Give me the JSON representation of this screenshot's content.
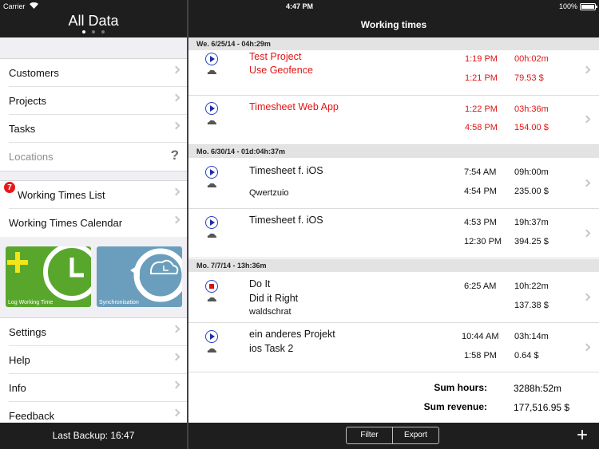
{
  "status_bar": {
    "carrier": "Carrier",
    "time": "4:47 PM",
    "battery": "100%"
  },
  "sidebar": {
    "title": "All Data",
    "group1": [
      {
        "label": "Customers"
      },
      {
        "label": "Projects"
      },
      {
        "label": "Tasks"
      },
      {
        "label": "Locations",
        "accessory": "?"
      }
    ],
    "group2": [
      {
        "label": "Working Times List",
        "badge": "7"
      },
      {
        "label": "Working Times Calendar"
      }
    ],
    "tiles": [
      {
        "label": "Log Working Time",
        "color": "#59a62d"
      },
      {
        "label": "Synchronisation",
        "color": "#6a9ebc"
      }
    ],
    "group3": [
      {
        "label": "Settings"
      },
      {
        "label": "Help"
      },
      {
        "label": "Info"
      },
      {
        "label": "Feedback"
      }
    ],
    "last_backup": "Last Backup: 16:47"
  },
  "main": {
    "title": "Working times",
    "sections": [
      {
        "header": "We. 6/25/14 - 04h:29m",
        "entries": [
          {
            "project": "Test Project",
            "task": "Use Geofence",
            "customer": "",
            "start": "1:19 PM",
            "end": "1:21 PM",
            "duration": "00h:02m",
            "amount": "79.53 $",
            "highlight": "#e01414",
            "state": "play"
          },
          {
            "project": "Timesheet Web App",
            "task": "",
            "customer": "",
            "start": "1:22 PM",
            "end": "4:58 PM",
            "duration": "03h:36m",
            "amount": "154.00 $",
            "highlight": "#e01414",
            "state": "play"
          }
        ]
      },
      {
        "header": "Mo. 6/30/14 - 01d:04h:37m",
        "entries": [
          {
            "project": "Timesheet f. iOS",
            "task": "",
            "customer": "Qwertzuio",
            "start": "7:54 AM",
            "end": "4:54 PM",
            "duration": "09h:00m",
            "amount": "235.00 $",
            "state": "play"
          },
          {
            "project": "Timesheet f. iOS",
            "task": "",
            "customer": "",
            "start": "4:53 PM",
            "end": "12:30 PM",
            "duration": "19h:37m",
            "amount": "394.25 $",
            "state": "play"
          }
        ]
      },
      {
        "header": "Mo. 7/7/14 - 13h:36m",
        "entries": [
          {
            "project": "Do It",
            "task": "Did it Right",
            "customer": "waldschrat",
            "start": "6:25 AM",
            "end": "",
            "duration": "10h:22m",
            "amount": "137.38 $",
            "state": "stop"
          },
          {
            "project": "ein anderes Projekt",
            "task": "ios Task 2",
            "customer": "",
            "start": "10:44 AM",
            "end": "1:58 PM",
            "duration": "03h:14m",
            "amount": "0.64 $",
            "state": "play"
          }
        ]
      }
    ],
    "sum_hours_label": "Sum hours:",
    "sum_hours": "3288h:52m",
    "sum_revenue_label": "Sum revenue:",
    "sum_revenue": "177,516.95 $"
  },
  "toolbar": {
    "filter": "Filter",
    "export": "Export",
    "add": "+"
  }
}
